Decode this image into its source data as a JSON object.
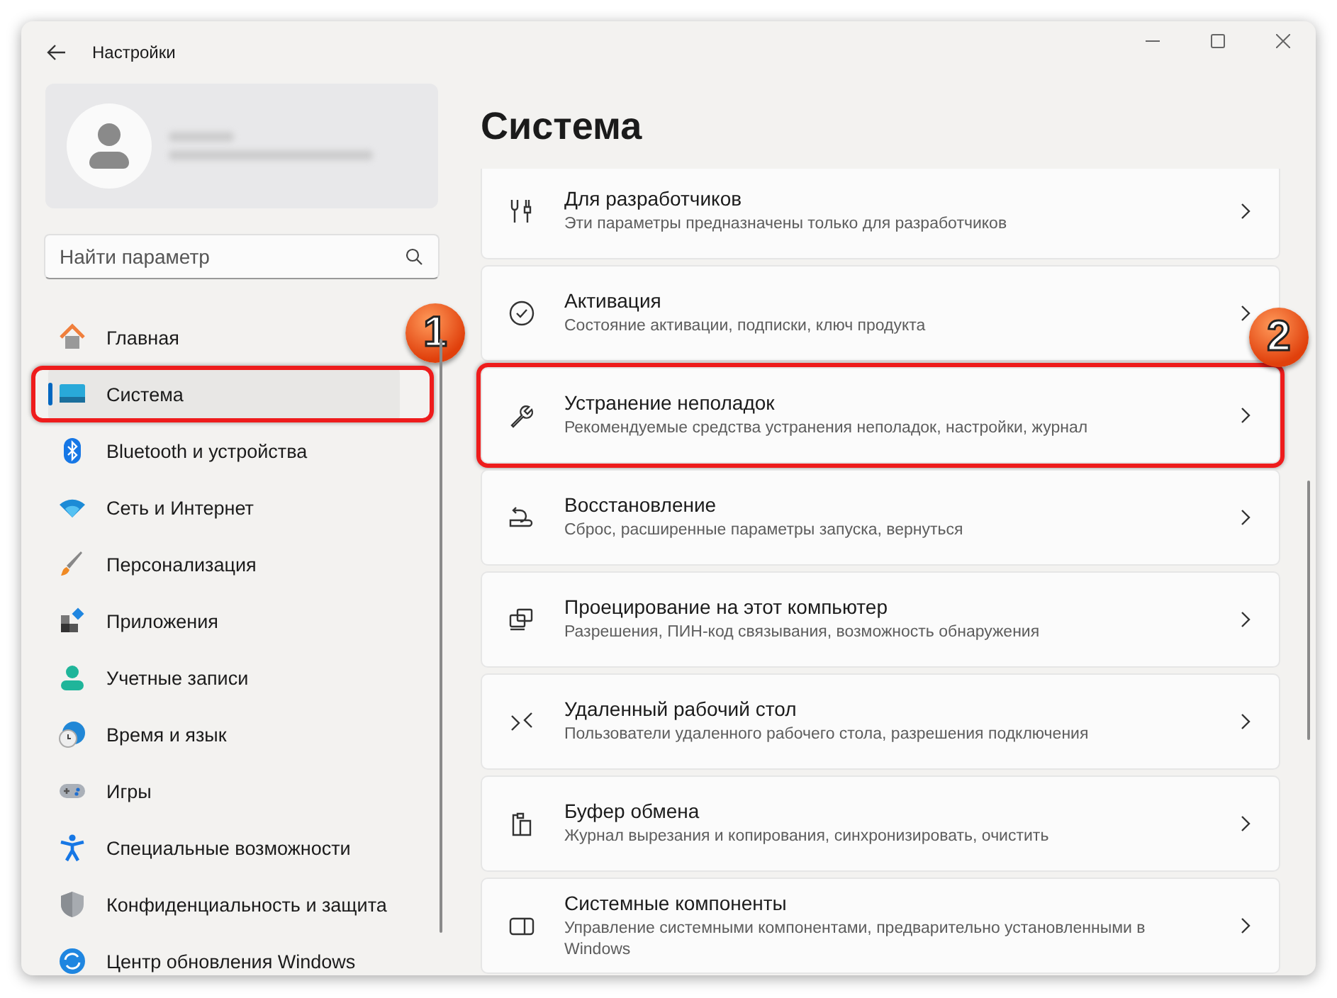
{
  "window": {
    "title": "Настройки"
  },
  "search": {
    "placeholder": "Найти параметр"
  },
  "nav": [
    {
      "label": "Главная",
      "selected": false,
      "highlighted": false
    },
    {
      "label": "Система",
      "selected": true,
      "highlighted": true,
      "callout": "1"
    },
    {
      "label": "Bluetooth и устройства",
      "selected": false,
      "highlighted": false
    },
    {
      "label": "Сеть и Интернет",
      "selected": false,
      "highlighted": false
    },
    {
      "label": "Персонализация",
      "selected": false,
      "highlighted": false
    },
    {
      "label": "Приложения",
      "selected": false,
      "highlighted": false
    },
    {
      "label": "Учетные записи",
      "selected": false,
      "highlighted": false
    },
    {
      "label": "Время и язык",
      "selected": false,
      "highlighted": false
    },
    {
      "label": "Игры",
      "selected": false,
      "highlighted": false
    },
    {
      "label": "Специальные возможности",
      "selected": false,
      "highlighted": false
    },
    {
      "label": "Конфиденциальность и защита",
      "selected": false,
      "highlighted": false
    },
    {
      "label": "Центр обновления Windows",
      "selected": false,
      "highlighted": false
    }
  ],
  "page_title": "Система",
  "cards": [
    {
      "title": "Для разработчиков",
      "description": "Эти параметры предназначены только для разработчиков",
      "highlighted": false
    },
    {
      "title": "Активация",
      "description": "Состояние активации, подписки, ключ продукта",
      "highlighted": false
    },
    {
      "title": "Устранение неполадок",
      "description": "Рекомендуемые средства устранения неполадок, настройки, журнал",
      "highlighted": true,
      "callout": "2"
    },
    {
      "title": "Восстановление",
      "description": "Сброс, расширенные параметры запуска, вернуться",
      "highlighted": false
    },
    {
      "title": "Проецирование на этот компьютер",
      "description": "Разрешения, ПИН-код связывания, возможность обнаружения",
      "highlighted": false
    },
    {
      "title": "Удаленный рабочий стол",
      "description": "Пользователи удаленного рабочего стола, разрешения подключения",
      "highlighted": false
    },
    {
      "title": "Буфер обмена",
      "description": "Журнал вырезания и копирования, синхронизировать, очистить",
      "highlighted": false
    },
    {
      "title": "Системные компоненты",
      "description": "Управление системными компонентами, предварительно установленными в Windows",
      "highlighted": false
    }
  ]
}
